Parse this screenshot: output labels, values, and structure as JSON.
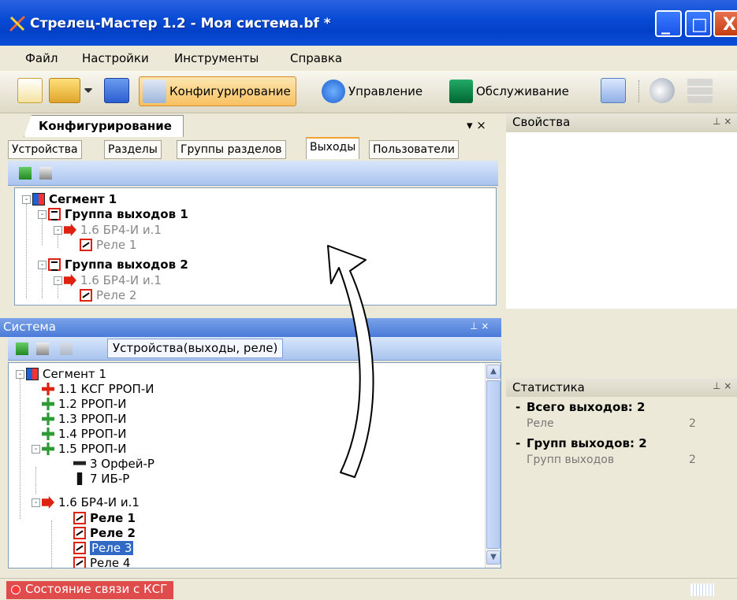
{
  "window": {
    "title": "Стрелец-Мастер 1.2 - Моя система.bf *",
    "min": "_",
    "max": "□",
    "close": "X"
  },
  "menu": [
    "Файл",
    "Настройки",
    "Инструменты",
    "Справка"
  ],
  "toolbar": {
    "configure": "Конфигурирование",
    "control": "Управление",
    "service": "Обслуживание"
  },
  "config_panel": {
    "title": "Конфигурирование",
    "close": "▾ ×",
    "tabs": [
      "Устройства",
      "Разделы",
      "Группы разделов",
      "Выходы",
      "Пользователи"
    ],
    "selected_tab": "Выходы",
    "tree": [
      {
        "label": "Сегмент 1"
      },
      {
        "label": "Группа выходов 1"
      },
      {
        "label": "1.6 БР4-И и.1"
      },
      {
        "label": "Реле 1"
      },
      {
        "label": "Группа выходов 2"
      },
      {
        "label": "1.6 БР4-И и.1"
      },
      {
        "label": "Реле 2"
      }
    ]
  },
  "system_panel": {
    "title": "Система",
    "pin": "⊥ ×",
    "filter": "Устройства(выходы, реле)",
    "tree": [
      {
        "label": "Сегмент 1"
      },
      {
        "label": "1.1 КСГ РРОП-И"
      },
      {
        "label": "1.2 РРОП-И"
      },
      {
        "label": "1.3 РРОП-И"
      },
      {
        "label": "1.4 РРОП-И"
      },
      {
        "label": "1.5 РРОП-И"
      },
      {
        "label": "3 Орфей-Р"
      },
      {
        "label": "7 ИБ-Р"
      },
      {
        "label": "1.6 БР4-И и.1"
      },
      {
        "label": "Реле 1"
      },
      {
        "label": "Реле 2"
      },
      {
        "label": "Реле 3"
      },
      {
        "label": "Реле 4"
      }
    ]
  },
  "properties_panel": {
    "title": "Свойства",
    "pin": "⊥ ×"
  },
  "stats_panel": {
    "title": "Статистика",
    "pin": "⊥ ×",
    "groups": [
      {
        "title": "Всего выходов: 2",
        "prop": "Реле",
        "value": "2"
      },
      {
        "title": "Групп выходов: 2",
        "prop": "Групп выходов",
        "value": "2"
      }
    ]
  },
  "status": {
    "text": "Состояние связи с КСГ"
  },
  "colors": {
    "titlebar": "#0a4bd6",
    "accent_orange": "#f2a231",
    "status_red": "#e04b4b",
    "selection": "#316ac5"
  }
}
